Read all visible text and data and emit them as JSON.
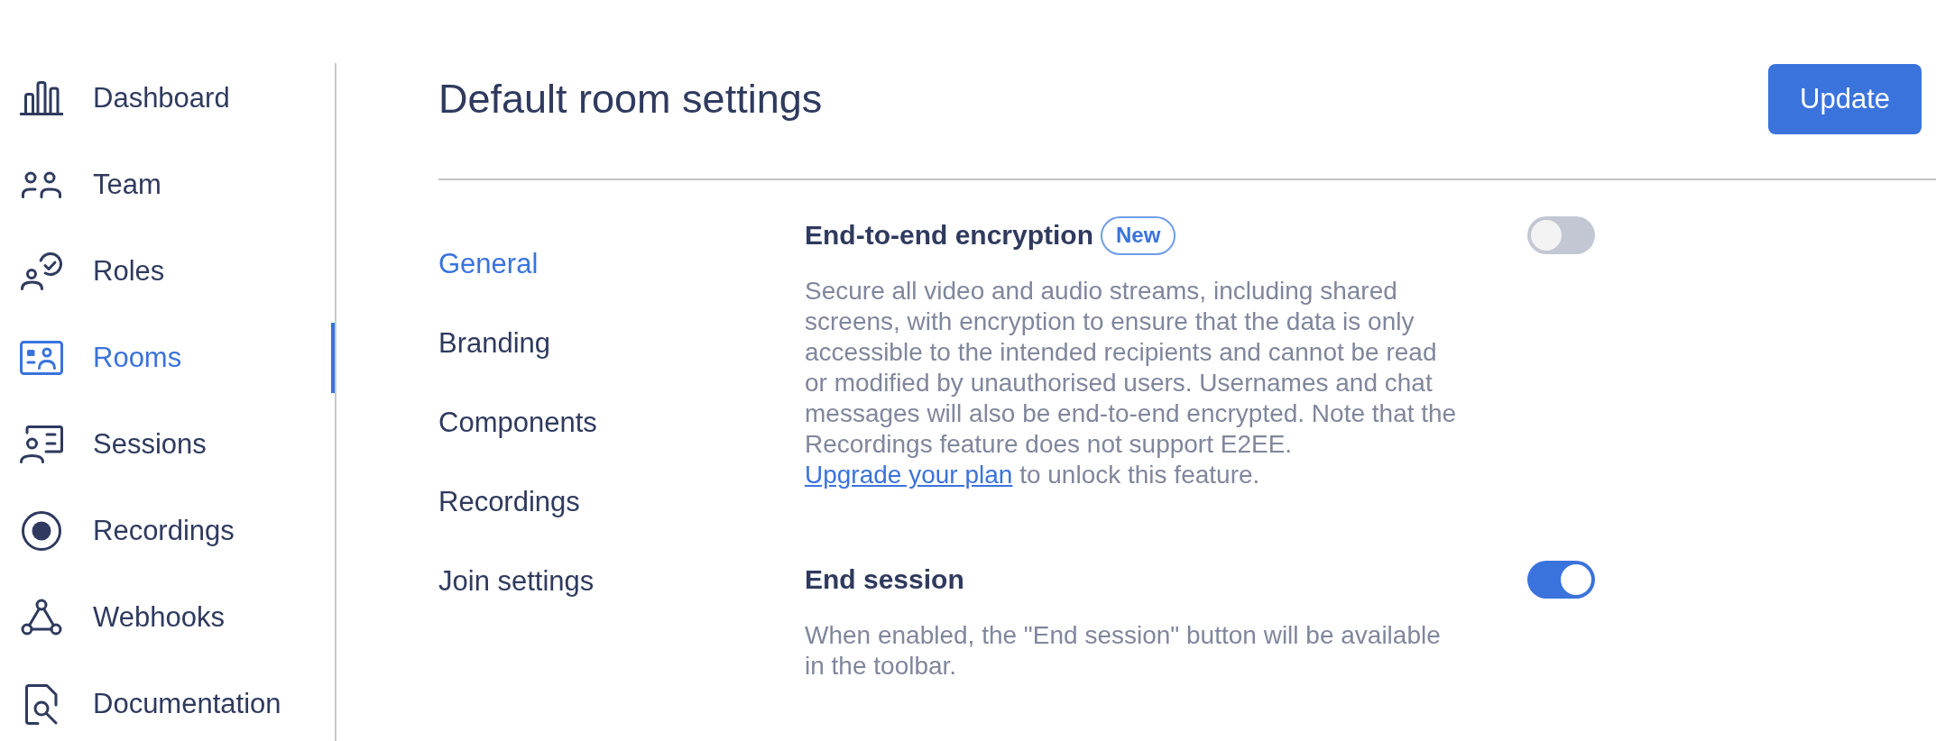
{
  "sidebar": {
    "items": [
      {
        "label": "Dashboard",
        "selected": false
      },
      {
        "label": "Team",
        "selected": false
      },
      {
        "label": "Roles",
        "selected": false
      },
      {
        "label": "Rooms",
        "selected": true
      },
      {
        "label": "Sessions",
        "selected": false
      },
      {
        "label": "Recordings",
        "selected": false
      },
      {
        "label": "Webhooks",
        "selected": false
      },
      {
        "label": "Documentation",
        "selected": false
      }
    ]
  },
  "header": {
    "title": "Default room settings",
    "button": "Update"
  },
  "subnav": {
    "items": [
      {
        "label": "General",
        "selected": true
      },
      {
        "label": "Branding",
        "selected": false
      },
      {
        "label": "Components",
        "selected": false
      },
      {
        "label": "Recordings",
        "selected": false
      },
      {
        "label": "Join settings",
        "selected": false
      }
    ]
  },
  "settings": [
    {
      "title": "End-to-end encryption",
      "badge": "New",
      "description": "Secure all video and audio streams, including shared screens, with encryption to ensure that the data is only accessible to the intended recipients and cannot be read or modified by unauthorised users. Usernames and chat messages will also be end-to-end encrypted. Note that the Recordings feature does not support E2EE.",
      "link": "Upgrade your plan",
      "description_end": "to unlock this feature.",
      "on": false
    },
    {
      "title": "End session",
      "description": "When enabled, the \"End session\" button will be available in the toolbar.",
      "on": true
    }
  ]
}
